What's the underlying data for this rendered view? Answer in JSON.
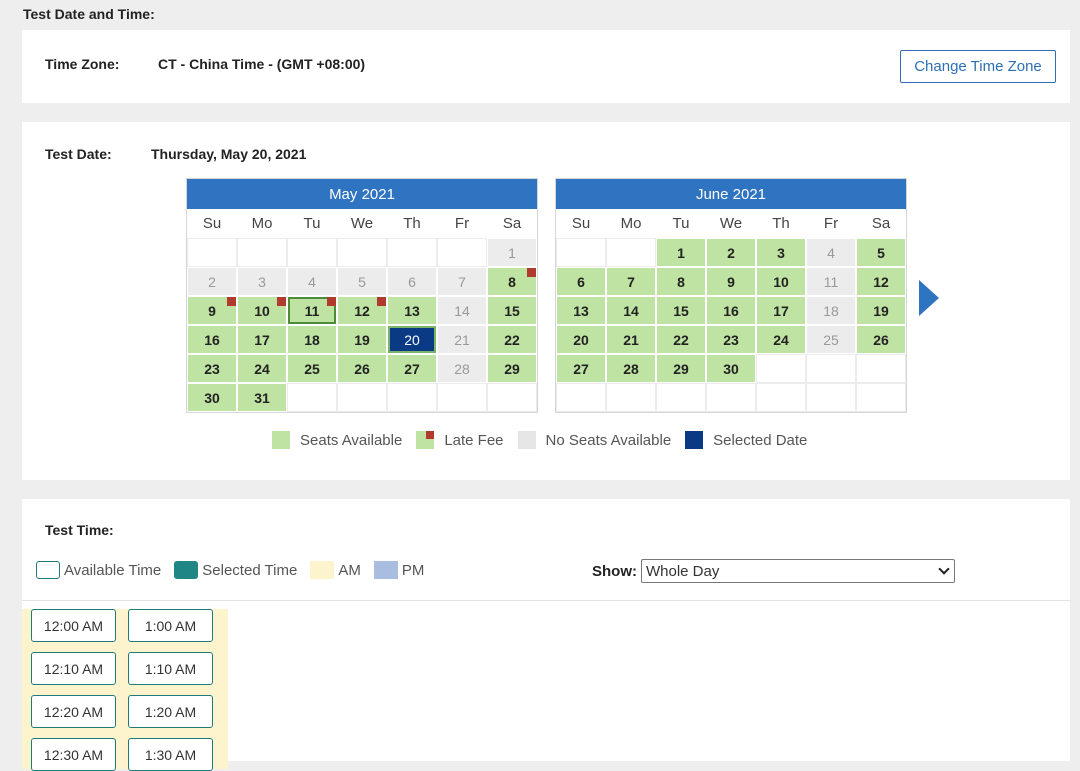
{
  "section_title": "Test Date and Time:",
  "timezone": {
    "label": "Time Zone:",
    "value": "CT - China Time - (GMT +08:00)",
    "change_button": "Change Time Zone"
  },
  "test_date": {
    "label": "Test Date:",
    "value": "Thursday, May 20, 2021"
  },
  "weekdays": [
    "Su",
    "Mo",
    "Tu",
    "We",
    "Th",
    "Fr",
    "Sa"
  ],
  "calendars": [
    {
      "month": "May 2021",
      "days": [
        {
          "d": "",
          "s": "empty"
        },
        {
          "d": "",
          "s": "empty"
        },
        {
          "d": "",
          "s": "empty"
        },
        {
          "d": "",
          "s": "empty"
        },
        {
          "d": "",
          "s": "empty"
        },
        {
          "d": "",
          "s": "empty"
        },
        {
          "d": "1",
          "s": "past"
        },
        {
          "d": "2",
          "s": "past"
        },
        {
          "d": "3",
          "s": "past"
        },
        {
          "d": "4",
          "s": "past"
        },
        {
          "d": "5",
          "s": "past"
        },
        {
          "d": "6",
          "s": "past"
        },
        {
          "d": "7",
          "s": "past"
        },
        {
          "d": "8",
          "s": "avail",
          "late": true
        },
        {
          "d": "9",
          "s": "avail",
          "late": true
        },
        {
          "d": "10",
          "s": "avail",
          "late": true
        },
        {
          "d": "11",
          "s": "avail",
          "late": true,
          "today": true
        },
        {
          "d": "12",
          "s": "avail",
          "late": true
        },
        {
          "d": "13",
          "s": "avail"
        },
        {
          "d": "14",
          "s": "nosvc"
        },
        {
          "d": "15",
          "s": "avail"
        },
        {
          "d": "16",
          "s": "avail"
        },
        {
          "d": "17",
          "s": "avail"
        },
        {
          "d": "18",
          "s": "avail"
        },
        {
          "d": "19",
          "s": "avail"
        },
        {
          "d": "20",
          "s": "selected"
        },
        {
          "d": "21",
          "s": "nosvc"
        },
        {
          "d": "22",
          "s": "avail"
        },
        {
          "d": "23",
          "s": "avail"
        },
        {
          "d": "24",
          "s": "avail"
        },
        {
          "d": "25",
          "s": "avail"
        },
        {
          "d": "26",
          "s": "avail"
        },
        {
          "d": "27",
          "s": "avail"
        },
        {
          "d": "28",
          "s": "nosvc"
        },
        {
          "d": "29",
          "s": "avail"
        },
        {
          "d": "30",
          "s": "avail"
        },
        {
          "d": "31",
          "s": "avail"
        },
        {
          "d": "",
          "s": "empty"
        },
        {
          "d": "",
          "s": "empty"
        },
        {
          "d": "",
          "s": "empty"
        },
        {
          "d": "",
          "s": "empty"
        },
        {
          "d": "",
          "s": "empty"
        }
      ]
    },
    {
      "month": "June 2021",
      "days": [
        {
          "d": "",
          "s": "empty"
        },
        {
          "d": "",
          "s": "empty"
        },
        {
          "d": "1",
          "s": "avail"
        },
        {
          "d": "2",
          "s": "avail"
        },
        {
          "d": "3",
          "s": "avail"
        },
        {
          "d": "4",
          "s": "nosvc"
        },
        {
          "d": "5",
          "s": "avail"
        },
        {
          "d": "6",
          "s": "avail"
        },
        {
          "d": "7",
          "s": "avail"
        },
        {
          "d": "8",
          "s": "avail"
        },
        {
          "d": "9",
          "s": "avail"
        },
        {
          "d": "10",
          "s": "avail"
        },
        {
          "d": "11",
          "s": "nosvc"
        },
        {
          "d": "12",
          "s": "avail"
        },
        {
          "d": "13",
          "s": "avail"
        },
        {
          "d": "14",
          "s": "avail"
        },
        {
          "d": "15",
          "s": "avail"
        },
        {
          "d": "16",
          "s": "avail"
        },
        {
          "d": "17",
          "s": "avail"
        },
        {
          "d": "18",
          "s": "nosvc"
        },
        {
          "d": "19",
          "s": "avail"
        },
        {
          "d": "20",
          "s": "avail"
        },
        {
          "d": "21",
          "s": "avail"
        },
        {
          "d": "22",
          "s": "avail"
        },
        {
          "d": "23",
          "s": "avail"
        },
        {
          "d": "24",
          "s": "avail"
        },
        {
          "d": "25",
          "s": "nosvc"
        },
        {
          "d": "26",
          "s": "avail"
        },
        {
          "d": "27",
          "s": "avail"
        },
        {
          "d": "28",
          "s": "avail"
        },
        {
          "d": "29",
          "s": "avail"
        },
        {
          "d": "30",
          "s": "avail"
        },
        {
          "d": "",
          "s": "empty"
        },
        {
          "d": "",
          "s": "empty"
        },
        {
          "d": "",
          "s": "empty"
        },
        {
          "d": "",
          "s": "empty"
        },
        {
          "d": "",
          "s": "empty"
        },
        {
          "d": "",
          "s": "empty"
        },
        {
          "d": "",
          "s": "empty"
        },
        {
          "d": "",
          "s": "empty"
        },
        {
          "d": "",
          "s": "empty"
        },
        {
          "d": "",
          "s": "empty"
        }
      ]
    }
  ],
  "date_legend": {
    "seats_available": "Seats Available",
    "late_fee": "Late Fee",
    "no_seats": "No Seats Available",
    "selected_date": "Selected Date"
  },
  "test_time": {
    "label": "Test Time:",
    "legend": {
      "available": "Available Time",
      "selected": "Selected Time",
      "am": "AM",
      "pm": "PM"
    },
    "show_label": "Show:",
    "show_value": "Whole Day",
    "times": [
      [
        "12:00 AM",
        "1:00 AM"
      ],
      [
        "12:10 AM",
        "1:10 AM"
      ],
      [
        "12:20 AM",
        "1:20 AM"
      ],
      [
        "12:30 AM",
        "1:30 AM"
      ]
    ]
  },
  "colors": {
    "header_blue": "#2f74c0",
    "available_green": "#bfe3a3",
    "late_fee_red": "#b03a2e",
    "no_seats_gray": "#ececec",
    "selected_navy": "#0b3a84",
    "time_teal": "#1f8585",
    "am_yellow": "#fdf3cd",
    "pm_blue": "#a9bde0"
  }
}
